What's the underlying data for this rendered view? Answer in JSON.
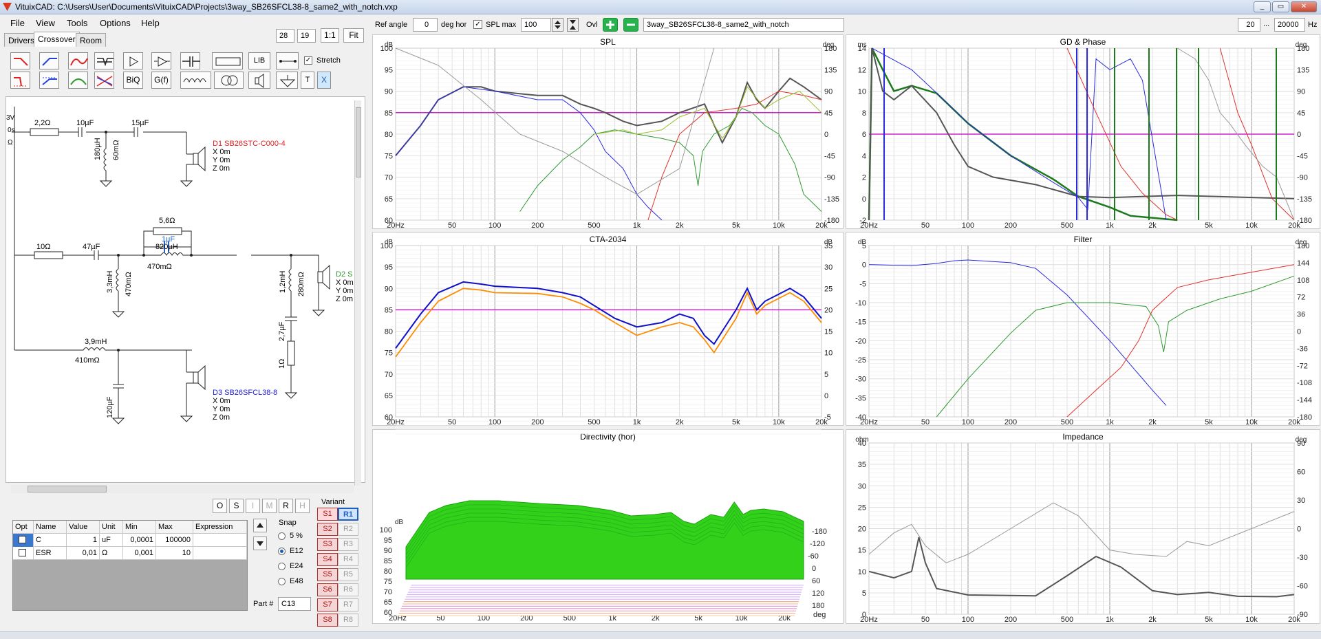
{
  "title": "VituixCAD: C:\\Users\\User\\Documents\\VituixCAD\\Projects\\3way_SB26SFCL38-8_same2_with_notch.vxp",
  "window_buttons": [
    "_",
    "▭",
    "✕"
  ],
  "menu": [
    "File",
    "View",
    "Tools",
    "Options",
    "Help"
  ],
  "tabs": [
    "Drivers",
    "Crossover",
    "Room"
  ],
  "zoom": {
    "a": "28",
    "b": "19",
    "one": "1:1",
    "fit": "Fit"
  },
  "palette_row1": [
    "LIB",
    "Stretch"
  ],
  "palette_row2": [
    "BiQ",
    "G(f)",
    "T",
    "X"
  ],
  "left_edge": [
    "3V",
    "0s",
    "Ω"
  ],
  "schematic": {
    "r1": "2,2Ω",
    "c1": "10µF",
    "c2": "15µF",
    "l1a": "180µH",
    "l1b": "60mΩ",
    "d1": "D1 SB26STC-C000-4",
    "xyz": [
      "X 0m",
      "Y 0m",
      "Z 0m"
    ],
    "r56": "5,6Ω",
    "c1u": "1µF",
    "r10": "10Ω",
    "c47": "47µF",
    "l820": "820µH",
    "l820r": "470mΩ",
    "l33": "3,3mH",
    "l33r": "470mΩ",
    "l12": "1,2mH",
    "l12r": "280mΩ",
    "c27": "2,7µF",
    "r1o": "1Ω",
    "d2": "D2 S",
    "l39": "3,9mH",
    "l39r": "410mΩ",
    "c120": "120µF",
    "d3": "D3 SB26SFCL38-8"
  },
  "tool_buttons": [
    "O",
    "S",
    "I",
    "M",
    "R",
    "H"
  ],
  "table": {
    "headers": [
      "Opt",
      "Name",
      "Value",
      "Unit",
      "Min",
      "Max",
      "Expression"
    ],
    "rows": [
      [
        "",
        "C",
        "1",
        "uF",
        "0,0001",
        "100000",
        ""
      ],
      [
        "",
        "ESR",
        "0,01",
        "Ω",
        "0,001",
        "10",
        ""
      ]
    ]
  },
  "snap": {
    "label": "Snap",
    "options": [
      "5 %",
      "E12",
      "E24",
      "E48"
    ],
    "selected": "E12"
  },
  "part": {
    "label": "Part #",
    "value": "C13"
  },
  "variant": {
    "label": "Variant",
    "s": [
      "S1",
      "S2",
      "S3",
      "S4",
      "S5",
      "S6",
      "S7",
      "S8"
    ],
    "r": [
      "R1",
      "R2",
      "R3",
      "R4",
      "R5",
      "R6",
      "R7",
      "R8"
    ]
  },
  "topbar": {
    "ref_angle_label": "Ref angle",
    "ref_angle": "0",
    "deg_hor": "deg hor",
    "spl_max_label": "SPL max",
    "spl_max": "100",
    "ovl": "Ovl",
    "project": "3way_SB26SFCL38-8_same2_with_notch",
    "f_from": "20",
    "dots": "...",
    "f_to": "20000",
    "hz": "Hz"
  },
  "freq_ticks": [
    "20Hz",
    "50",
    "100",
    "200",
    "500",
    "1k",
    "2k",
    "5k",
    "10k",
    "20k"
  ],
  "spl": {
    "title": "SPL",
    "yl": "dB",
    "yr": "deg",
    "left": [
      "100",
      "95",
      "90",
      "85",
      "80",
      "75",
      "70",
      "65",
      "60"
    ],
    "right": [
      "180",
      "135",
      "90",
      "45",
      "0",
      "-45",
      "-90",
      "-135",
      "-180"
    ]
  },
  "gd": {
    "title": "GD & Phase",
    "yl": "ms",
    "yr": "deg",
    "left": [
      "14",
      "12",
      "10",
      "8",
      "6",
      "4",
      "2",
      "0",
      "-2"
    ],
    "right": [
      "180",
      "135",
      "90",
      "45",
      "0",
      "-45",
      "-90",
      "-135",
      "-180"
    ]
  },
  "cta": {
    "title": "CTA-2034",
    "yl": "dB",
    "yr": "dB",
    "left": [
      "100",
      "95",
      "90",
      "85",
      "80",
      "75",
      "70",
      "65",
      "60"
    ],
    "right": [
      "35",
      "30",
      "25",
      "20",
      "15",
      "10",
      "5",
      "0",
      "-5"
    ]
  },
  "filter": {
    "title": "Filter",
    "yl": "dB",
    "yr": "deg",
    "left": [
      "5",
      "0",
      "-5",
      "-10",
      "-15",
      "-20",
      "-25",
      "-30",
      "-35",
      "-40"
    ],
    "right": [
      "180",
      "144",
      "108",
      "72",
      "36",
      "0",
      "-36",
      "-72",
      "-108",
      "-144",
      "-180"
    ]
  },
  "dir": {
    "title": "Directivity (hor)",
    "yl": "dB",
    "left": [
      "100",
      "95",
      "90",
      "85",
      "80",
      "75",
      "70",
      "65",
      "60"
    ],
    "angles": [
      "-180",
      "-120",
      "-60",
      "0",
      "60",
      "120",
      "180"
    ],
    "deg": "deg",
    "ticks": [
      "20Hz",
      "50",
      "100",
      "200",
      "500",
      "1k",
      "2k",
      "5k",
      "10k",
      "20k"
    ]
  },
  "imp": {
    "title": "Impedance",
    "yl": "ohm",
    "yr": "deg",
    "left": [
      "40",
      "35",
      "30",
      "25",
      "20",
      "15",
      "10",
      "5",
      "0"
    ],
    "right": [
      "90",
      "60",
      "30",
      "0",
      "-30",
      "-60",
      "-90"
    ]
  },
  "colors": {
    "blue": "#2a2adf",
    "red": "#e0302a",
    "green": "#2e9a2e",
    "gray": "#9a9a9a",
    "dark": "#555555",
    "magenta": "#d020d0",
    "navy": "#1010c8",
    "orange": "#ff8c00"
  }
}
